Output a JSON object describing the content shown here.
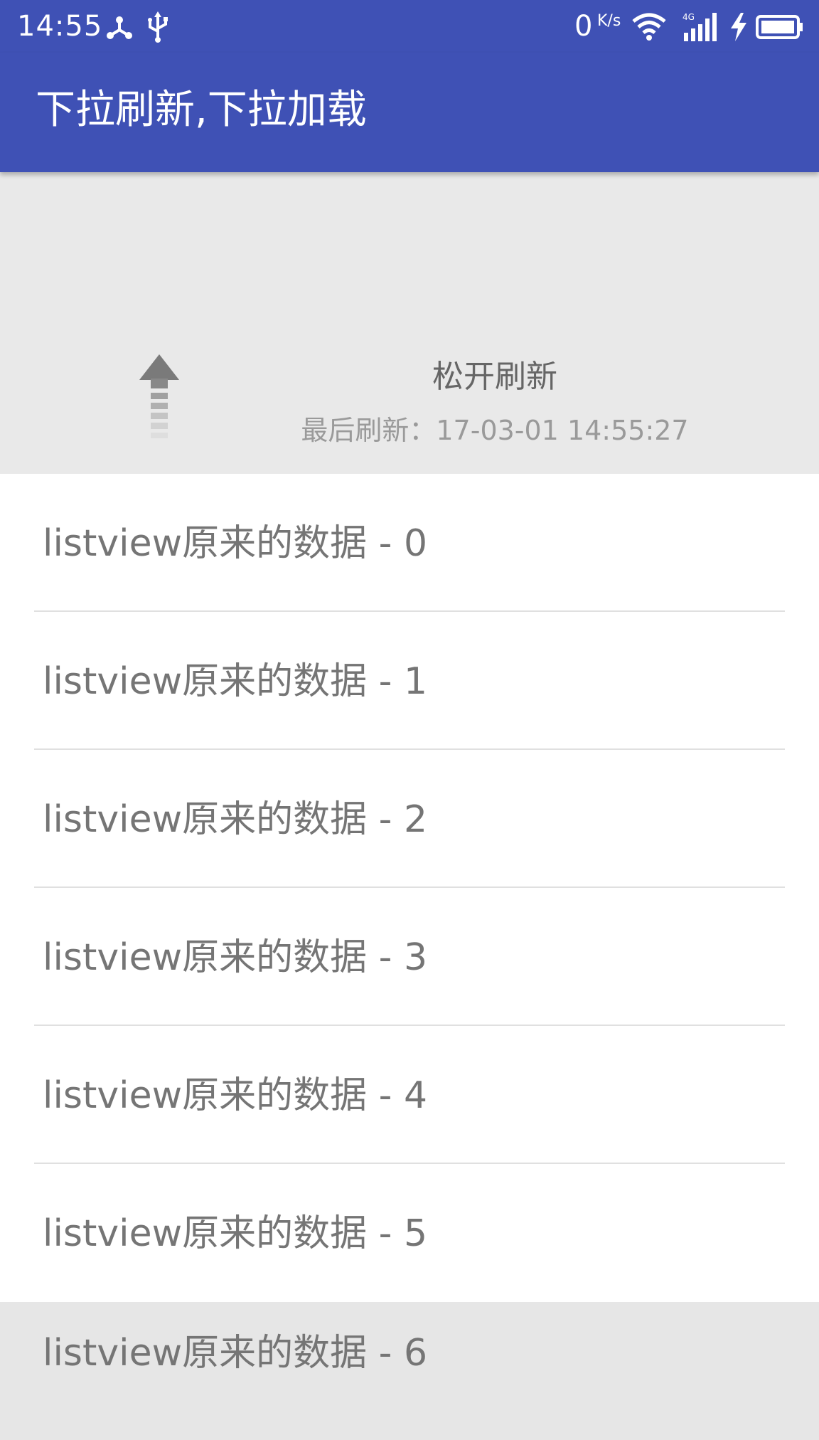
{
  "status_bar": {
    "time": "14:55",
    "net_speed": "0",
    "net_unit": "K/s",
    "network_type": "4G",
    "icons": [
      "share-icon",
      "usb-icon",
      "wifi-icon",
      "signal-icon",
      "charging-icon",
      "battery-icon"
    ]
  },
  "toolbar": {
    "title": "下拉刷新,下拉加载"
  },
  "pull_header": {
    "status": "松开刷新",
    "last_update": "最后刷新：17-03-01 14:55:27",
    "icon": "arrow-up-icon"
  },
  "list": {
    "items": [
      "listview原来的数据 - 0",
      "listview原来的数据 - 1",
      "listview原来的数据 - 2",
      "listview原来的数据 - 3",
      "listview原来的数据 - 4",
      "listview原来的数据 - 5",
      "listview原来的数据 - 6"
    ]
  },
  "colors": {
    "primary": "#3f51b5",
    "header_bg": "#e9e9e9",
    "text": "#757575",
    "divider": "#e0e0e0"
  }
}
